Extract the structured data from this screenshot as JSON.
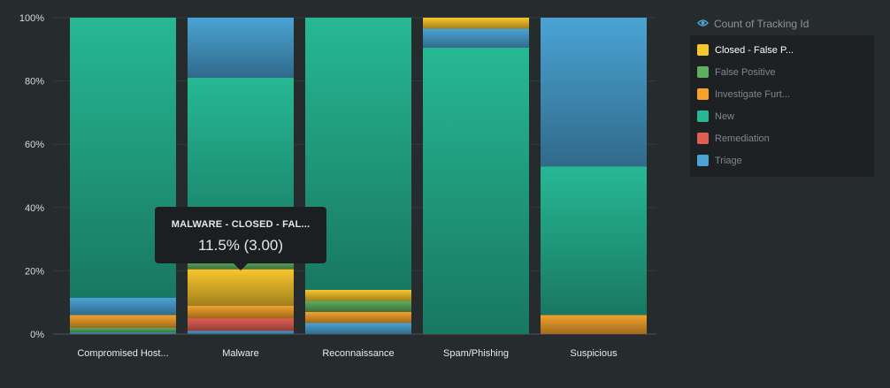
{
  "chart_data": {
    "type": "bar",
    "stacked": "percent",
    "categories": [
      "Compromised Host...",
      "Malware",
      "Reconnaissance",
      "Spam/Phishing",
      "Suspicious"
    ],
    "series": [
      {
        "name": "Triage",
        "color": "#4aa3d4",
        "values": [
          0.5,
          1.0,
          3.5,
          0,
          0
        ]
      },
      {
        "name": "Remediation",
        "color": "#e15f52",
        "values": [
          0,
          4.0,
          0,
          0,
          0
        ]
      },
      {
        "name": "Investigate Furt...",
        "color": "#f4a22d",
        "values": [
          0,
          4.0,
          3.5,
          0,
          0
        ]
      },
      {
        "name": "False Positive",
        "color": "#5dae5f",
        "values": [
          1.5,
          0,
          3.5,
          0,
          0
        ]
      },
      {
        "name": "Closed - False P...",
        "color": "#f8c62d",
        "values": [
          0,
          11.5,
          3.5,
          0,
          0
        ]
      },
      {
        "name": "Investigate Furt...",
        "color": "#f4a22d",
        "values": [
          4.0,
          0,
          0,
          0,
          6.0
        ]
      },
      {
        "name": "New",
        "color": "#26b895",
        "values": [
          0,
          0,
          0,
          90.5,
          47.0
        ]
      },
      {
        "name": "Triage",
        "color": "#4aa3d4",
        "values": [
          5.5,
          0,
          0,
          0,
          0
        ]
      },
      {
        "name": "False Positive",
        "color": "#5dae5f",
        "values": [
          0,
          2.5,
          0,
          0,
          0
        ]
      },
      {
        "name": "New",
        "color": "#26b895",
        "values": [
          88.5,
          58.0,
          86.0,
          0,
          0
        ]
      },
      {
        "name": "Triage",
        "color": "#4aa3d4",
        "values": [
          0,
          19.0,
          0,
          6.0,
          47.0
        ]
      },
      {
        "name": "Closed - False P...",
        "color": "#f8c62d",
        "values": [
          0,
          0,
          0,
          3.5,
          0
        ]
      }
    ],
    "yticks": [
      "0%",
      "20%",
      "40%",
      "60%",
      "80%",
      "100%"
    ],
    "ylim": [
      0,
      100
    ],
    "grid": true,
    "legend_position": "right"
  },
  "legend": {
    "title": "Count of Tracking Id",
    "items": [
      {
        "label": "Closed - False P...",
        "color": "#f8c62d",
        "active": true
      },
      {
        "label": "False Positive",
        "color": "#5dae5f",
        "active": false
      },
      {
        "label": "Investigate Furt...",
        "color": "#f4a22d",
        "active": false
      },
      {
        "label": "New",
        "color": "#26b895",
        "active": false
      },
      {
        "label": "Remediation",
        "color": "#e15f52",
        "active": false
      },
      {
        "label": "Triage",
        "color": "#4aa3d4",
        "active": false
      }
    ]
  },
  "tooltip": {
    "title": "MALWARE - CLOSED - FAL...",
    "value": "11.5% (3.00)"
  },
  "icons": {
    "legend_title_icon": "eye-icon"
  }
}
